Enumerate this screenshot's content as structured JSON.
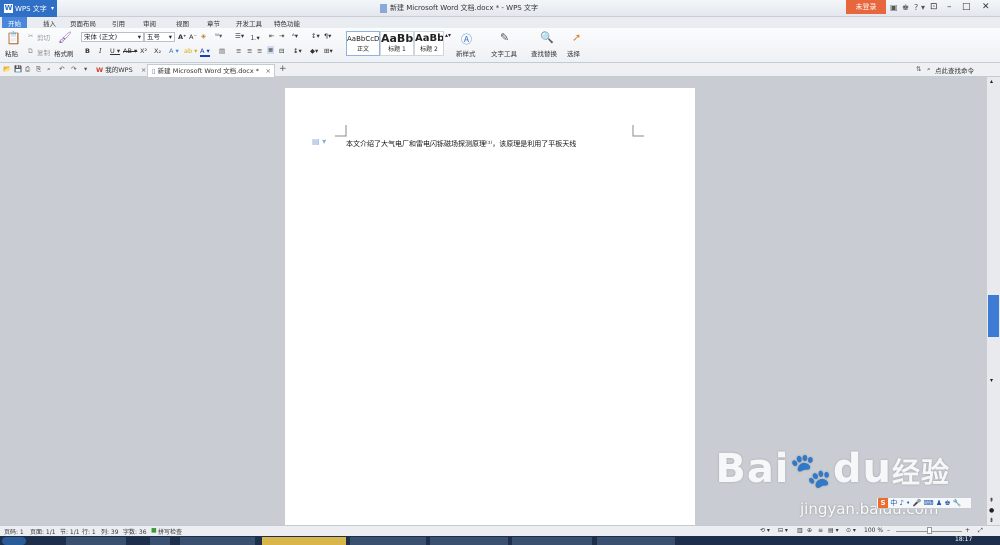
{
  "app": {
    "name": "WPS 文字",
    "window_title": "新建 Microsoft Word 文档.docx * - WPS 文字",
    "login_label": "未登录"
  },
  "menu_tabs": [
    "开始",
    "插入",
    "页面布局",
    "引用",
    "审阅",
    "视图",
    "章节",
    "开发工具",
    "特色功能"
  ],
  "ribbon": {
    "paste": "粘贴",
    "cut": "剪切",
    "copy": "复制",
    "format_painter": "格式刷",
    "font_name": "宋体 (正文)",
    "font_size": "五号",
    "styles": [
      {
        "preview": "AaBbCcDd",
        "label": "正文"
      },
      {
        "preview": "AaBb",
        "label": "标题 1"
      },
      {
        "preview": "AaBb(",
        "label": "标题 2"
      }
    ],
    "new_style": "新样式",
    "text_tools": "文字工具",
    "find_replace": "查找替换",
    "select": "选择"
  },
  "doc_tabs": {
    "my_wps": "我的WPS",
    "current_doc": "新建 Microsoft Word 文档.docx *",
    "help_search": "点此查找命令"
  },
  "document": {
    "text": "本文介绍了大气电厂和雷电闪铄磁场探测原理⁽¹⁾，该原理是利用了平板天线"
  },
  "status_bar": {
    "page": "页码: 1",
    "pages": "页面: 1/1",
    "section": "节: 1/1",
    "row": "行: 1",
    "col": "列: 39",
    "words": "字数: 36",
    "spellcheck": "拼写检查",
    "zoom": "100 %"
  },
  "clock": "18:17",
  "ime_label": "中",
  "watermark": {
    "brand": "Bai",
    "brand2": "du",
    "cn": "经验",
    "url": "jingyan.baidu.com"
  },
  "colors": {
    "accent": "#2f6fc6",
    "login": "#e8663d",
    "taskbar": "#1d2f4a"
  }
}
